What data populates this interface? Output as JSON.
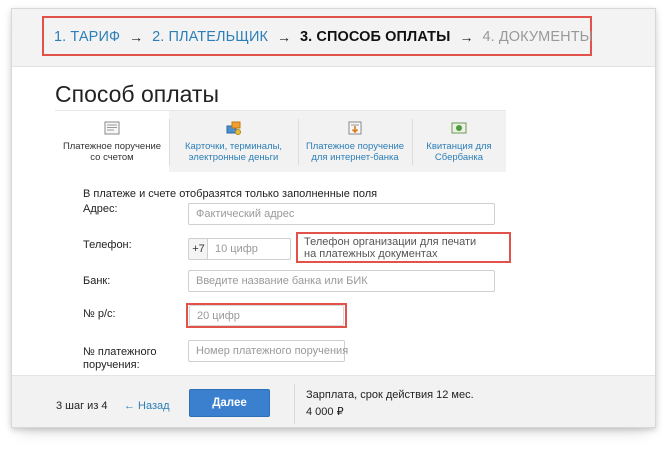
{
  "steps": [
    {
      "label": "1. ТАРИФ",
      "state": "link"
    },
    {
      "label": "2. ПЛАТЕЛЬЩИК",
      "state": "link"
    },
    {
      "label": "3. СПОСОБ ОПЛАТЫ",
      "state": "current"
    },
    {
      "label": "4. ДОКУМЕНТЫ",
      "state": "future"
    }
  ],
  "arrow": "→",
  "page_title": "Способ оплаты",
  "tabs": [
    {
      "line1": "Платежное поручение",
      "line2": "со счетом",
      "icon": "document-icon"
    },
    {
      "line1": "Карточки, терминалы,",
      "line2": "электронные деньги",
      "icon": "cards-icon"
    },
    {
      "line1": "Платежное поручение",
      "line2": "для интернет-банка",
      "icon": "download-document-icon"
    },
    {
      "line1": "Квитанция для",
      "line2": "Сбербанка",
      "icon": "receipt-icon"
    }
  ],
  "form": {
    "note": "В платеже и счете отобразятся только заполненные поля",
    "address_label": "Адрес:",
    "address_placeholder": "Фактический адрес",
    "phone_label": "Телефон:",
    "phone_prefix": "+7",
    "phone_placeholder": "10 цифр",
    "phone_hint_line1": "Телефон организации для печати",
    "phone_hint_line2": "на платежных документах",
    "bank_label": "Банк:",
    "bank_placeholder": "Введите название банка или БИК",
    "account_label": "№ р/с:",
    "account_placeholder": "20 цифр",
    "order_label_line1": "№ платежного",
    "order_label_line2": "поручения:",
    "order_placeholder": "Номер платежного поручения"
  },
  "footer": {
    "step_info": "3 шаг из 4",
    "back": "← Назад",
    "next": "Далее",
    "plan": "Зарплата, срок действия 12 мес.",
    "price": "4 000 ₽"
  },
  "colors": {
    "accent": "#2c7fb8",
    "highlight": "#e2524a",
    "button": "#3a80cf"
  }
}
